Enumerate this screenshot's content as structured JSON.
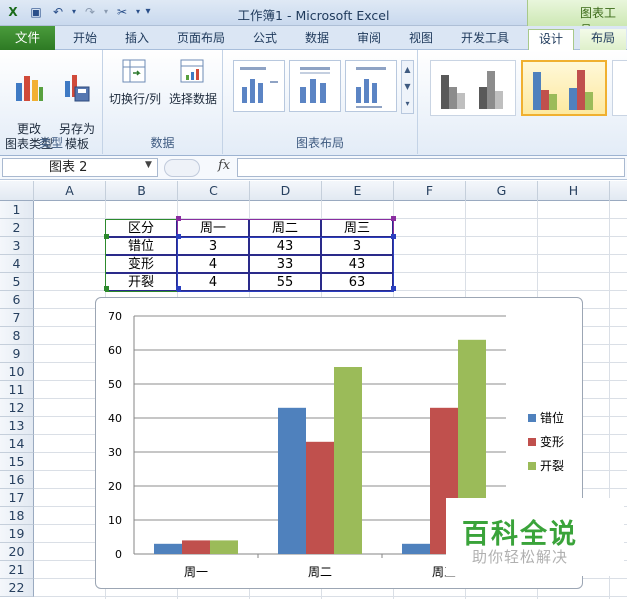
{
  "window": {
    "title": "工作簿1 - Microsoft Excel",
    "context_tab_title": "图表工具"
  },
  "ribbon_tabs": [
    "文件",
    "开始",
    "插入",
    "页面布局",
    "公式",
    "数据",
    "审阅",
    "视图",
    "开发工具",
    "设计",
    "布局"
  ],
  "active_tab": "设计",
  "ribbon": {
    "type_group": {
      "label": "类型",
      "change_type": "更改\n图表类型",
      "save_template": "另存为\n模板"
    },
    "data_group": {
      "label": "数据",
      "switch_row_col": "切换行/列",
      "select_data": "选择数据"
    },
    "layout_group": {
      "label": "图表布局"
    }
  },
  "formula_bar": {
    "name_box": "图表 2",
    "fx_label": "fx",
    "formula": ""
  },
  "columns": [
    "A",
    "B",
    "C",
    "D",
    "E",
    "F",
    "G",
    "H"
  ],
  "rows": [
    "1",
    "2",
    "3",
    "4",
    "5",
    "6",
    "7",
    "8",
    "9",
    "10",
    "11",
    "12",
    "13",
    "14",
    "15",
    "16",
    "17",
    "18",
    "19",
    "20",
    "21",
    "22"
  ],
  "table": {
    "header": [
      "区分",
      "周一",
      "周二",
      "周三"
    ],
    "rows": [
      [
        "错位",
        "3",
        "43",
        "3"
      ],
      [
        "变形",
        "4",
        "33",
        "43"
      ],
      [
        "开裂",
        "4",
        "55",
        "63"
      ]
    ]
  },
  "chart_data": {
    "type": "bar",
    "categories": [
      "周一",
      "周二",
      "周三"
    ],
    "series": [
      {
        "name": "错位",
        "values": [
          3,
          43,
          3
        ],
        "color": "#4f81bd"
      },
      {
        "name": "变形",
        "values": [
          4,
          33,
          43
        ],
        "color": "#c0504d"
      },
      {
        "name": "开裂",
        "values": [
          4,
          55,
          63
        ],
        "color": "#9bbb59"
      }
    ],
    "ylim": [
      0,
      70
    ],
    "yticks": [
      0,
      10,
      20,
      30,
      40,
      50,
      60,
      70
    ],
    "grid": true,
    "legend": "right"
  },
  "watermark": {
    "main": "百科全说",
    "sub": "助你轻松解决"
  }
}
